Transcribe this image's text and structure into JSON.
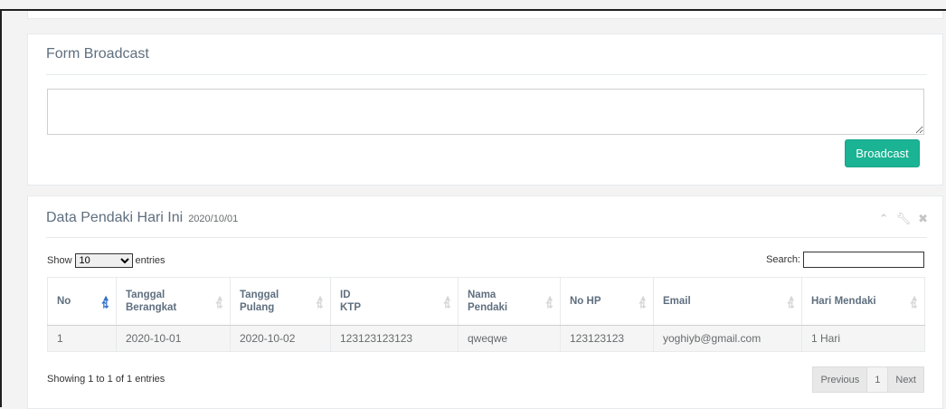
{
  "form": {
    "title": "Form Broadcast",
    "textarea_value": "",
    "button_label": "Broadcast"
  },
  "data_panel": {
    "title": "Data Pendaki Hari Ini",
    "date": "2020/10/01",
    "tools": {
      "collapse_icon": "^",
      "settings_icon": "wrench",
      "close_icon": "×"
    },
    "show_label": "Show",
    "entries_label": "entries",
    "length_selected": "10",
    "search_label": "Search:",
    "search_value": "",
    "columns": [
      "No",
      "Tanggal Berangkat",
      "Tanggal Pulang",
      "ID KTP",
      "Nama Pendaki",
      "No HP",
      "Email",
      "Hari Mendaki"
    ],
    "rows": [
      [
        "1",
        "2020-10-01",
        "2020-10-02",
        "123123123123",
        "qweqwe",
        "123123123",
        "yoghiyb@gmail.com",
        "1 Hari"
      ]
    ],
    "info": "Showing 1 to 1 of 1 entries",
    "pager": {
      "previous": "Previous",
      "page": "1",
      "next": "Next"
    }
  }
}
